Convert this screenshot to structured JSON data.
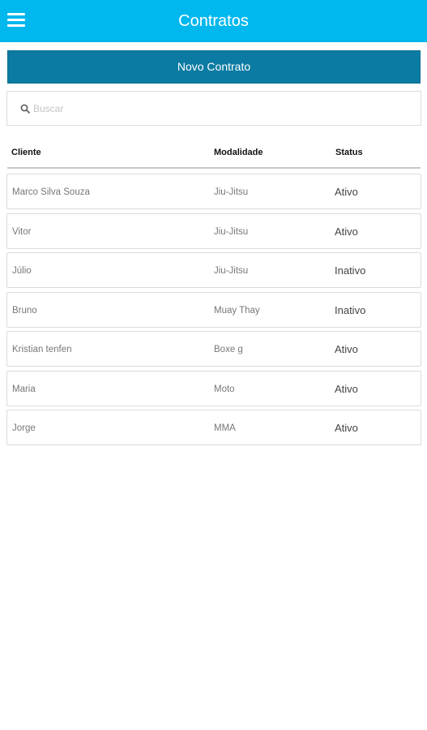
{
  "header": {
    "title": "Contratos"
  },
  "actions": {
    "new_contract_label": "Novo Contrato"
  },
  "search": {
    "placeholder": "Buscar",
    "value": ""
  },
  "table": {
    "columns": [
      "Cliente",
      "Modalidade",
      "Status"
    ],
    "rows": [
      {
        "cliente": "Marco Silva Souza",
        "modalidade": "Jiu-Jitsu",
        "status": "Ativo"
      },
      {
        "cliente": "Vitor",
        "modalidade": "Jiu-Jitsu",
        "status": "Ativo"
      },
      {
        "cliente": "Júlio",
        "modalidade": "Jiu-Jitsu",
        "status": "Inativo"
      },
      {
        "cliente": "Bruno",
        "modalidade": "Muay Thay",
        "status": "Inativo"
      },
      {
        "cliente": "Kristian tenfen",
        "modalidade": "Boxe g",
        "status": "Ativo"
      },
      {
        "cliente": "Maria",
        "modalidade": "Moto",
        "status": "Ativo"
      },
      {
        "cliente": "Jorge",
        "modalidade": "MMA",
        "status": "Ativo"
      }
    ]
  },
  "colors": {
    "topbar": "#00b7ee",
    "primary_button": "#0b7ba3"
  }
}
